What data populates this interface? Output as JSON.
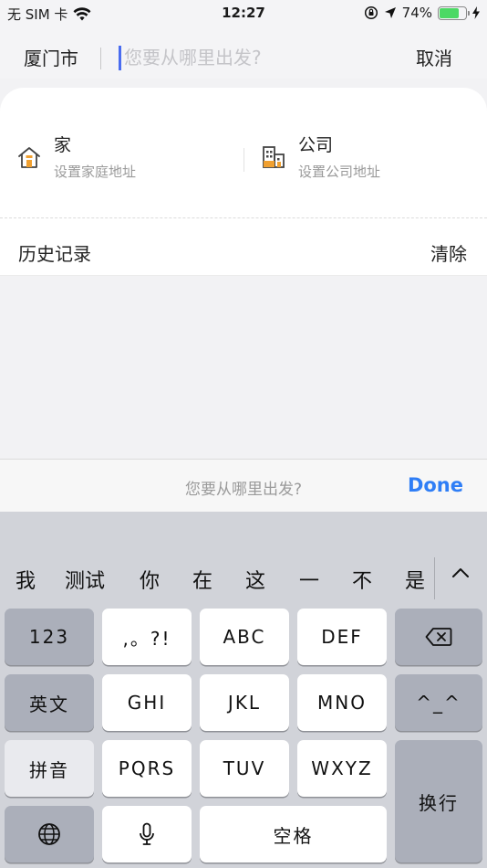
{
  "status": {
    "carrier": "无 SIM 卡",
    "time": "12:27",
    "battery_percent": "74%",
    "battery_level": 0.74
  },
  "search": {
    "city": "厦门市",
    "placeholder": "您要从哪里出发?",
    "cancel_label": "取消"
  },
  "quick_places": {
    "home": {
      "title": "家",
      "subtitle": "设置家庭地址"
    },
    "company": {
      "title": "公司",
      "subtitle": "设置公司地址"
    }
  },
  "history": {
    "title": "历史记录",
    "clear_label": "清除"
  },
  "accessory": {
    "hint": "您要从哪里出发?",
    "done_label": "Done"
  },
  "keyboard": {
    "candidates": [
      "我",
      "测试",
      "你",
      "在",
      "这",
      "一",
      "不",
      "是"
    ],
    "keys": {
      "num": "123",
      "punct": ",。?!",
      "abc": "ABC",
      "def": "DEF",
      "english": "英文",
      "ghi": "GHI",
      "jkl": "JKL",
      "mno": "MNO",
      "emoticon": "^_^",
      "pinyin": "拼音",
      "pqrs": "PQRS",
      "tuv": "TUV",
      "wxyz": "WXYZ",
      "return": "换行",
      "space": "空格"
    }
  },
  "icons": {
    "wifi": "wifi-icon",
    "orientation_lock": "orientation-lock-icon",
    "location": "location-arrow-icon",
    "charging": "charging-bolt-icon",
    "home": "home-icon",
    "company": "building-icon",
    "collapse": "chevron-up-icon",
    "delete": "backspace-icon",
    "globe": "globe-icon",
    "mic": "microphone-icon"
  },
  "colors": {
    "accent": "#2f7ef6",
    "caret": "#4a6cf0",
    "battery": "#4cd964",
    "icon_orange": "#f0a030"
  }
}
